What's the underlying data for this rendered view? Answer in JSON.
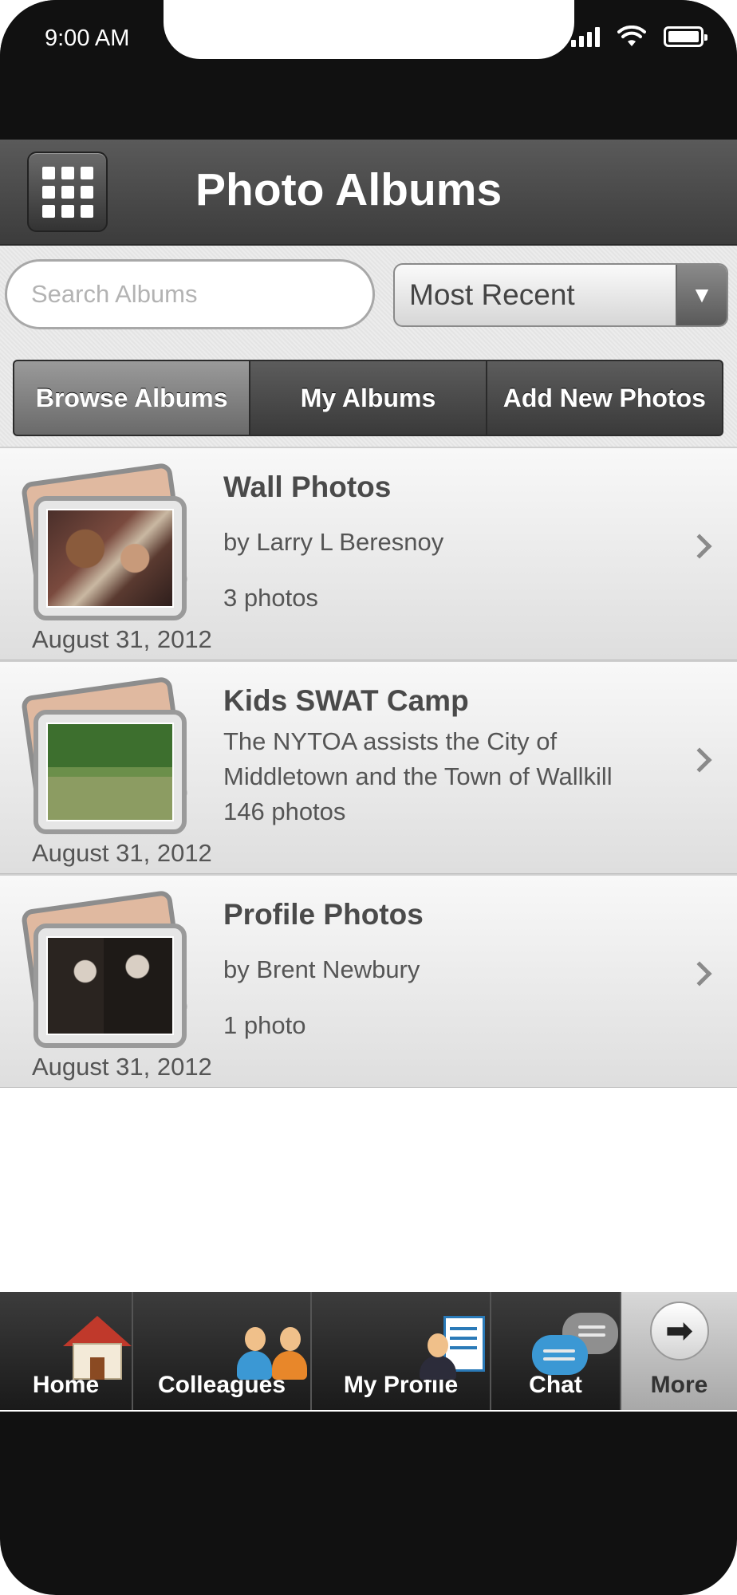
{
  "status_bar": {
    "time": "9:00 AM"
  },
  "header": {
    "title": "Photo Albums",
    "menu_icon": "grid-menu-icon"
  },
  "filters": {
    "search_placeholder": "Search Albums",
    "sort_value": "Most Recent"
  },
  "tabs": [
    {
      "label": "Browse Albums",
      "active": true
    },
    {
      "label": "My Albums",
      "active": false
    },
    {
      "label": "Add New Photos",
      "active": false
    }
  ],
  "albums": [
    {
      "title": "Wall Photos",
      "subtitle": "by Larry L Beresnoy",
      "count": "3 photos",
      "date": "August 31, 2012"
    },
    {
      "title": "Kids SWAT Camp",
      "subtitle": "The NYTOA assists the City of Middletown and the Town of Wallkill",
      "count": "146 photos",
      "date": "August 31, 2012"
    },
    {
      "title": "Profile Photos",
      "subtitle": "by Brent  Newbury",
      "count": "1 photo",
      "date": "August 31, 2012"
    }
  ],
  "bottom_nav": [
    {
      "label": "Home",
      "icon": "house-icon"
    },
    {
      "label": "Colleagues",
      "icon": "colleagues-icon"
    },
    {
      "label": "My Profile",
      "icon": "profile-icon"
    },
    {
      "label": "Chat",
      "icon": "chat-icon"
    },
    {
      "label": "More",
      "icon": "more-arrow-icon",
      "active": true
    }
  ]
}
